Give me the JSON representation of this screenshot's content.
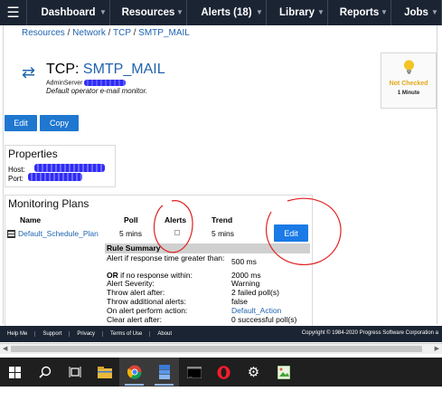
{
  "nav": {
    "menu_icon": "hamburger-menu-icon",
    "items": [
      "Dashboard",
      "Resources",
      "Alerts (18)",
      "Library",
      "Reports",
      "Jobs"
    ]
  },
  "breadcrumb": [
    "Resources",
    "Network",
    "TCP",
    "SMTP_MAIL"
  ],
  "header": {
    "prefix": "TCP:",
    "name": "SMTP_MAIL",
    "server": "AdminServer",
    "description": "Default operator e-mail monitor.",
    "icon": "swap-arrows-icon"
  },
  "status": {
    "label": "Not Checked",
    "interval": "1 Minute",
    "icon": "lightbulb-icon",
    "color": "#e0a81a"
  },
  "actions": {
    "edit": "Edit",
    "copy": "Copy"
  },
  "properties": {
    "title": "Properties",
    "host_label": "Host:",
    "port_label": "Port:"
  },
  "monitoring": {
    "title": "Monitoring Plans",
    "columns": [
      "Name",
      "Poll",
      "Alerts",
      "Trend"
    ],
    "plan": {
      "name": "Default_Schedule_Plan",
      "poll": "5 mins",
      "trend": "5 mins",
      "edit": "Edit"
    },
    "rule_summary": "Rule Summary",
    "rules": [
      {
        "label": "Alert if response time greater than:",
        "value": "500 ms"
      },
      {
        "label_bold": "OR",
        "label": " if no response within:",
        "value": "2000 ms"
      },
      {
        "label": "Alert Severity:",
        "value": "Warning"
      },
      {
        "label": "Throw alert after:",
        "value": "2 failed poll(s)"
      },
      {
        "label": "Throw additional alerts:",
        "value": "false"
      },
      {
        "label": "On alert perform action:",
        "value": "Default_Action"
      },
      {
        "label": "Clear alert after:",
        "value": "0 successful poll(s)"
      }
    ]
  },
  "footer": {
    "links": [
      "Help Me",
      "Support",
      "Privacy",
      "Terms of Use",
      "About"
    ],
    "copyright": "Copyright © 1984-2020 Progress Software Corporation a"
  },
  "colors": {
    "nav_bg": "#1b2432",
    "link": "#1f63b0",
    "button": "#1f77d0",
    "annotation": "#e02020"
  }
}
